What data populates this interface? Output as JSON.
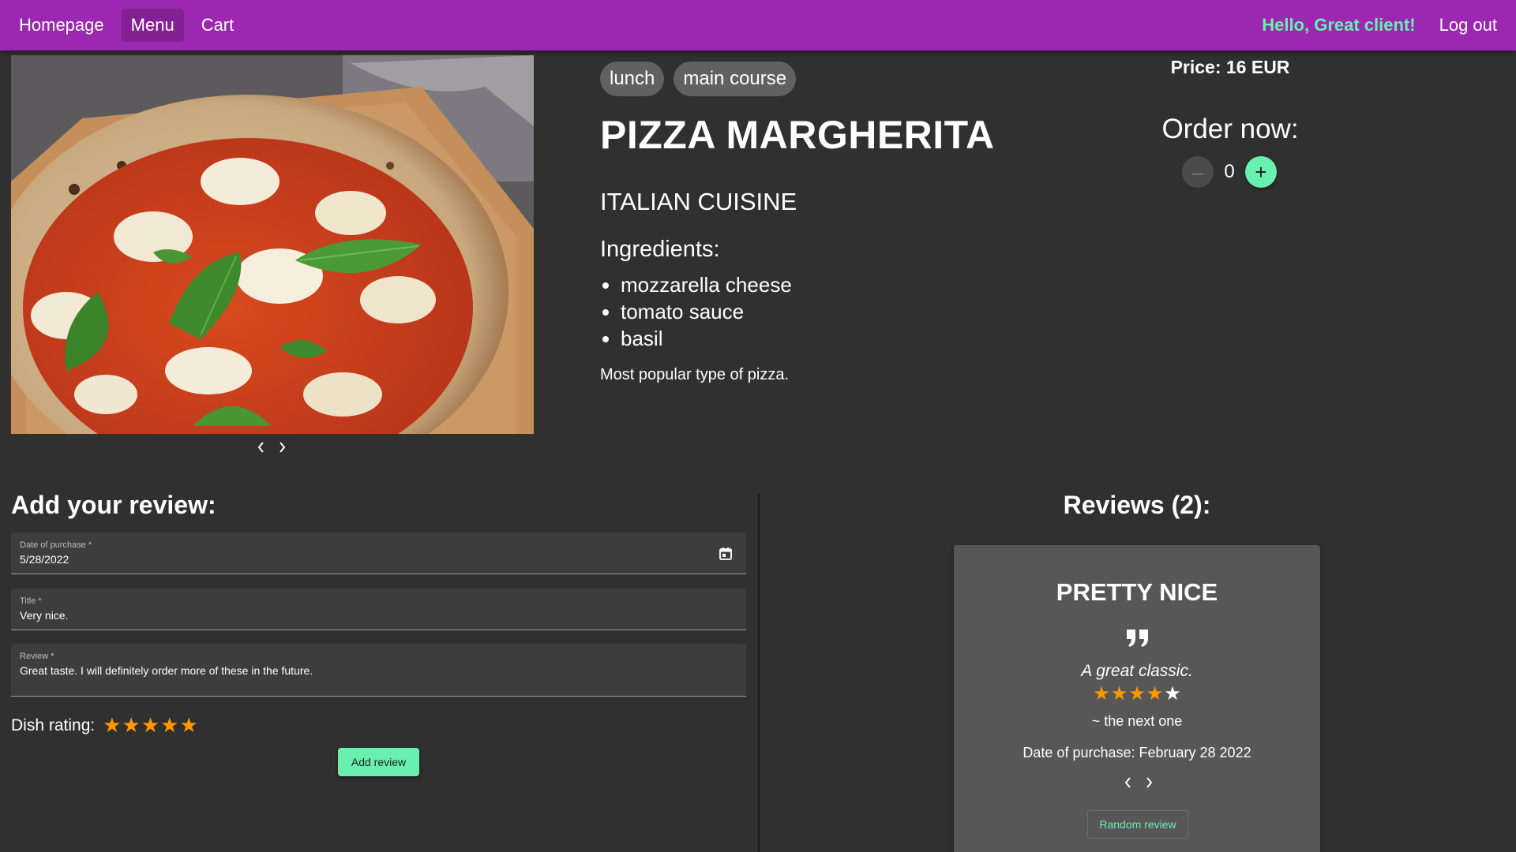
{
  "nav": {
    "items": [
      "Homepage",
      "Menu",
      "Cart"
    ],
    "active_item": "Menu",
    "greeting": "Hello, Great client!",
    "logout_label": "Log out"
  },
  "gallery": {
    "image_alt": "Pizza Margherita"
  },
  "dish": {
    "tags": [
      "lunch",
      "main course"
    ],
    "name": "PIZZA MARGHERITA",
    "cuisine": "ITALIAN CUISINE",
    "ingredients_heading": "Ingredients:",
    "ingredients": [
      "mozzarella cheese",
      "tomato sauce",
      "basil"
    ],
    "description": "Most popular type of pizza.",
    "price_label": "Price: 16 EUR"
  },
  "order": {
    "title": "Order now:",
    "quantity": "0",
    "decrement_symbol": "–",
    "increment_symbol": "+"
  },
  "add_review": {
    "heading": "Add your review:",
    "date_label": "Date of purchase *",
    "date_value": "5/28/2022",
    "title_label": "Title *",
    "title_value": "Very nice.",
    "review_label": "Review *",
    "review_value": "Great taste. I will definitely order more of these in the future.",
    "rating_label": "Dish rating:",
    "rating": 5,
    "rating_max": 5,
    "submit_label": "Add review"
  },
  "reviews": {
    "heading": "Reviews (2):",
    "current": {
      "title": "PRETTY NICE",
      "text": "A great classic.",
      "rating": 4,
      "rating_max": 5,
      "author": "~ the next one",
      "date": "Date of purchase: February 28 2022"
    },
    "random_label": "Random review"
  },
  "colors": {
    "navbar": "#9c27b0",
    "accent": "#69f0ae",
    "star": "#ff9800",
    "background": "#303030",
    "card": "#575757"
  },
  "icons": {
    "calendar": "calendar-icon",
    "quote": "quote-icon",
    "prev": "chevron-left-icon",
    "next": "chevron-right-icon"
  }
}
